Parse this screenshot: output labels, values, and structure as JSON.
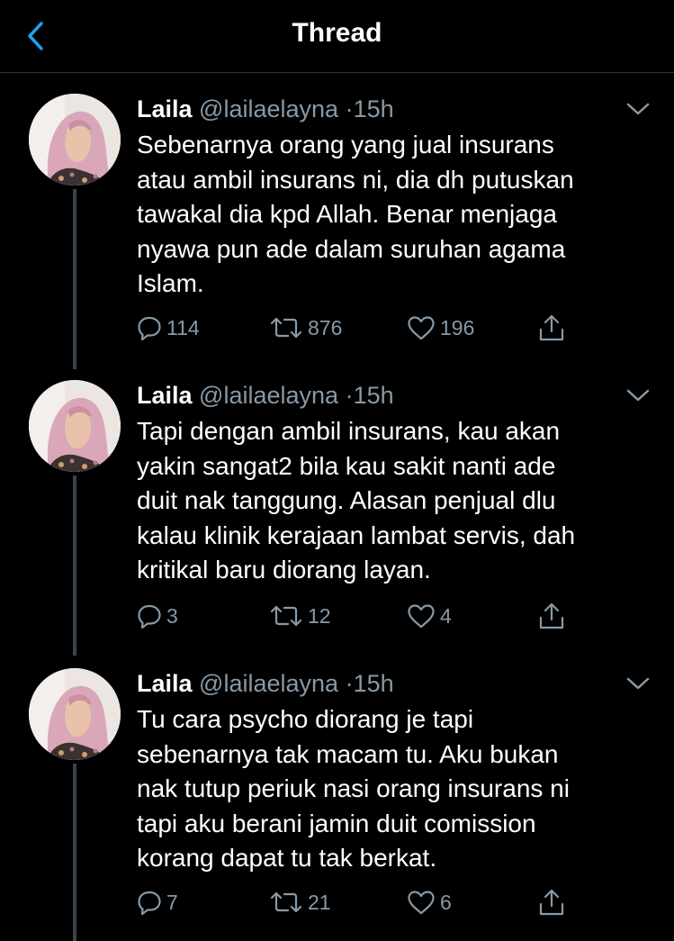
{
  "header": {
    "title": "Thread",
    "back_icon": "chevron-left-icon"
  },
  "colors": {
    "background": "#000000",
    "accent": "#1da1f2",
    "muted": "#8899a6",
    "thread_line": "#38444d"
  },
  "tweets": [
    {
      "author_name": "Laila",
      "handle": "@lailaelayna",
      "separator": "·",
      "time": "15h",
      "lines": [
        "Sebenarnya orang yang jual insurans",
        "atau ambil insurans ni, dia dh putuskan",
        "tawakal dia kpd Allah. Benar menjaga",
        "nyawa pun ade dalam suruhan agama",
        "Islam."
      ],
      "reply_count": "114",
      "retweet_count": "876",
      "like_count": "196"
    },
    {
      "author_name": "Laila",
      "handle": "@lailaelayna",
      "separator": "·",
      "time": "15h",
      "lines": [
        "Tapi dengan ambil insurans, kau akan",
        "yakin sangat2 bila kau sakit nanti ade",
        "duit nak tanggung. Alasan penjual dlu",
        "kalau klinik kerajaan lambat servis, dah",
        "kritikal baru diorang layan."
      ],
      "reply_count": "3",
      "retweet_count": "12",
      "like_count": "4"
    },
    {
      "author_name": "Laila",
      "handle": "@lailaelayna",
      "separator": "·",
      "time": "15h",
      "lines": [
        "Tu cara psycho diorang je tapi",
        "sebenarnya tak macam tu. Aku bukan",
        "nak tutup periuk nasi orang insurans ni",
        "tapi aku berani jamin duit comission",
        "korang dapat tu tak berkat."
      ],
      "reply_count": "7",
      "retweet_count": "21",
      "like_count": "6"
    }
  ]
}
